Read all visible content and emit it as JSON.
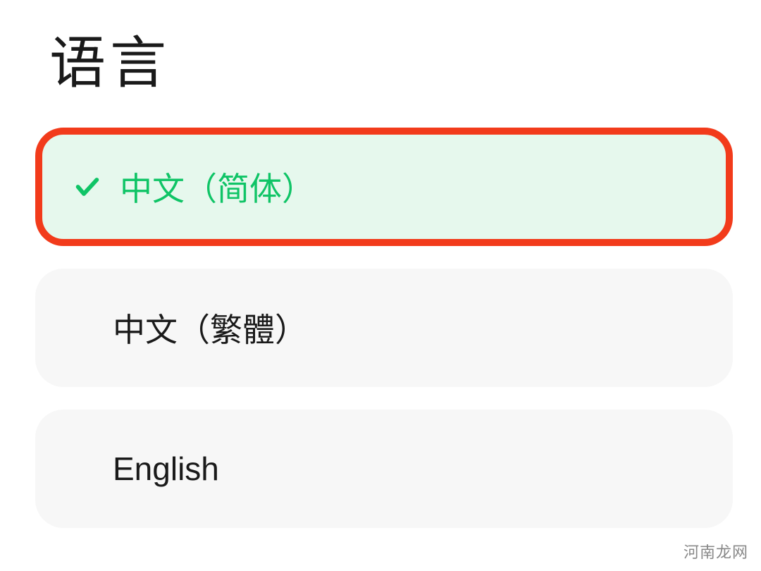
{
  "page": {
    "title": "语言"
  },
  "options": [
    {
      "label": "中文（简体）",
      "selected": true
    },
    {
      "label": "中文（繁體）",
      "selected": false
    },
    {
      "label": "English",
      "selected": false
    }
  ],
  "watermark": "河南龙网",
  "colors": {
    "accent": "#0fc466",
    "highlight_border": "#f23b1b",
    "selected_bg": "#e6f8ed",
    "unselected_bg": "#f7f7f7"
  }
}
